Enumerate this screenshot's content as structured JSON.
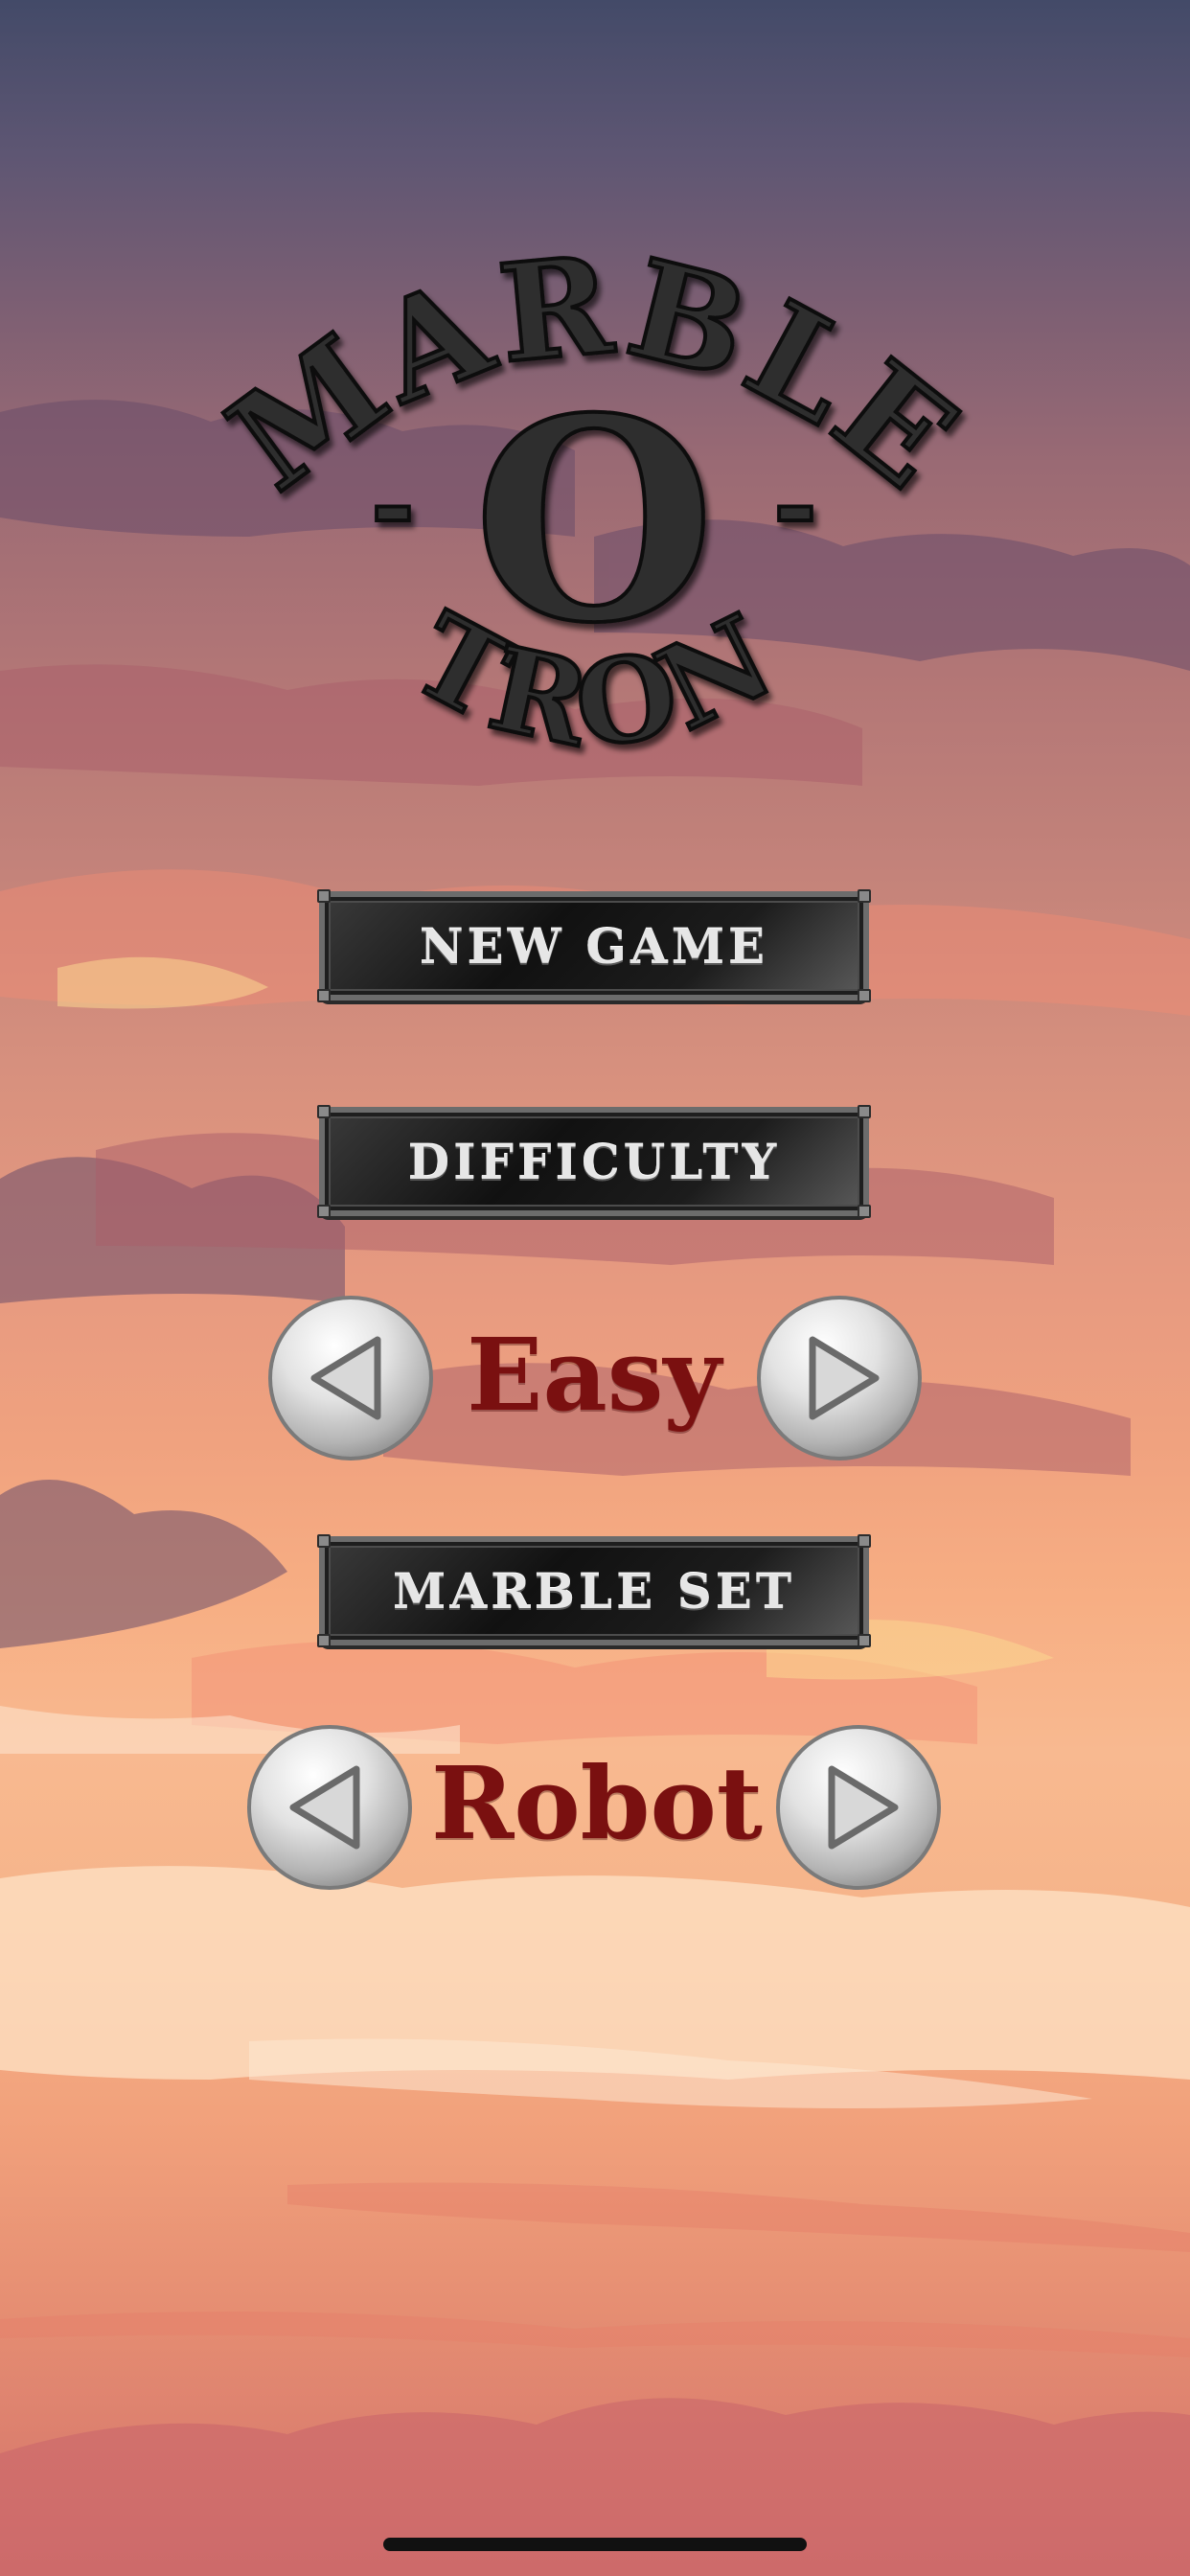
{
  "logo": {
    "word_top": "MARBLE",
    "word_middle": "O",
    "word_bottom": "TRON",
    "dash_left": "-",
    "dash_right": "-"
  },
  "menu": {
    "new_game_label": "NEW GAME",
    "difficulty_label": "DIFFICULTY",
    "difficulty_value": "Easy",
    "marble_set_label": "MARBLE SET",
    "marble_set_value": "Robot"
  },
  "icons": {
    "prev": "left-arrow-icon",
    "next": "right-arrow-icon"
  },
  "colors": {
    "value_text": "#7a1010",
    "plate_text": "#e6e6e6",
    "logo_text": "#2e2e2e"
  }
}
